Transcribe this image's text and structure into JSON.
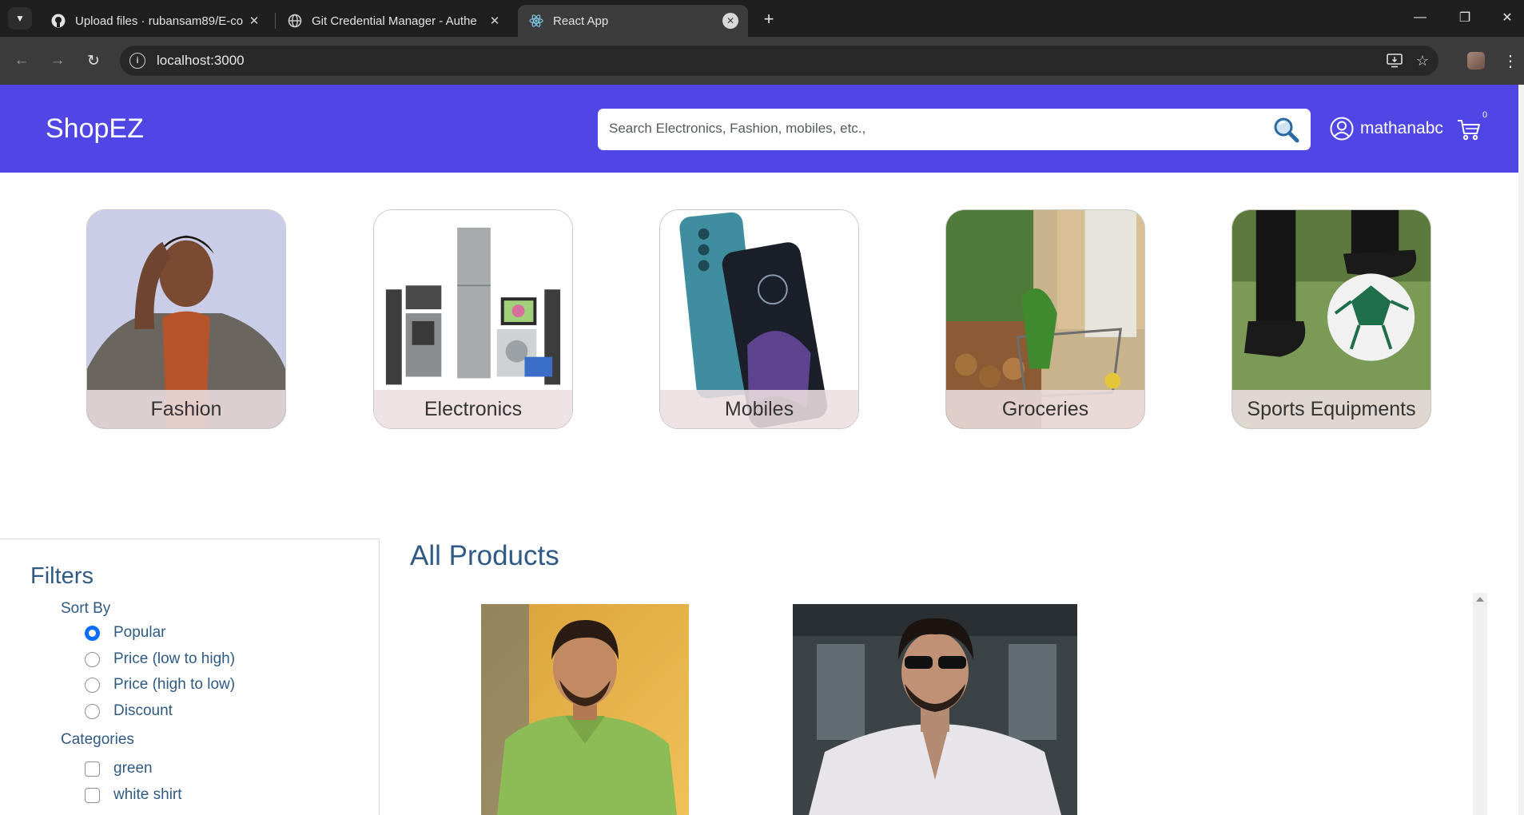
{
  "browser": {
    "tabs": [
      {
        "title": "Upload files · rubansam89/E-co",
        "icon": "github-icon",
        "active": false
      },
      {
        "title": "Git Credential Manager - Authe",
        "icon": "globe-icon",
        "active": false
      },
      {
        "title": "React App",
        "icon": "react-icon",
        "active": true
      }
    ],
    "url": "localhost:3000"
  },
  "header": {
    "brand": "ShopEZ",
    "search_placeholder": "Search Electronics, Fashion, mobiles, etc.,",
    "username": "mathanabc",
    "cart_count": "0",
    "colors": {
      "header_bg": "#5046e5",
      "link_text": "#2f5a84",
      "radio_accent": "#0d6efd"
    }
  },
  "categories": [
    {
      "label": "Fashion"
    },
    {
      "label": "Electronics"
    },
    {
      "label": "Mobiles"
    },
    {
      "label": "Groceries"
    },
    {
      "label": "Sports Equipments"
    }
  ],
  "filters": {
    "title": "Filters",
    "sort_heading": "Sort By",
    "sort_options": [
      {
        "label": "Popular",
        "checked": true
      },
      {
        "label": "Price (low to high)",
        "checked": false
      },
      {
        "label": "Price (high to low)",
        "checked": false
      },
      {
        "label": "Discount",
        "checked": false
      }
    ],
    "categories_heading": "Categories",
    "category_options": [
      {
        "label": "green",
        "checked": false
      },
      {
        "label": "white shirt",
        "checked": false
      }
    ]
  },
  "products": {
    "title": "All Products"
  }
}
